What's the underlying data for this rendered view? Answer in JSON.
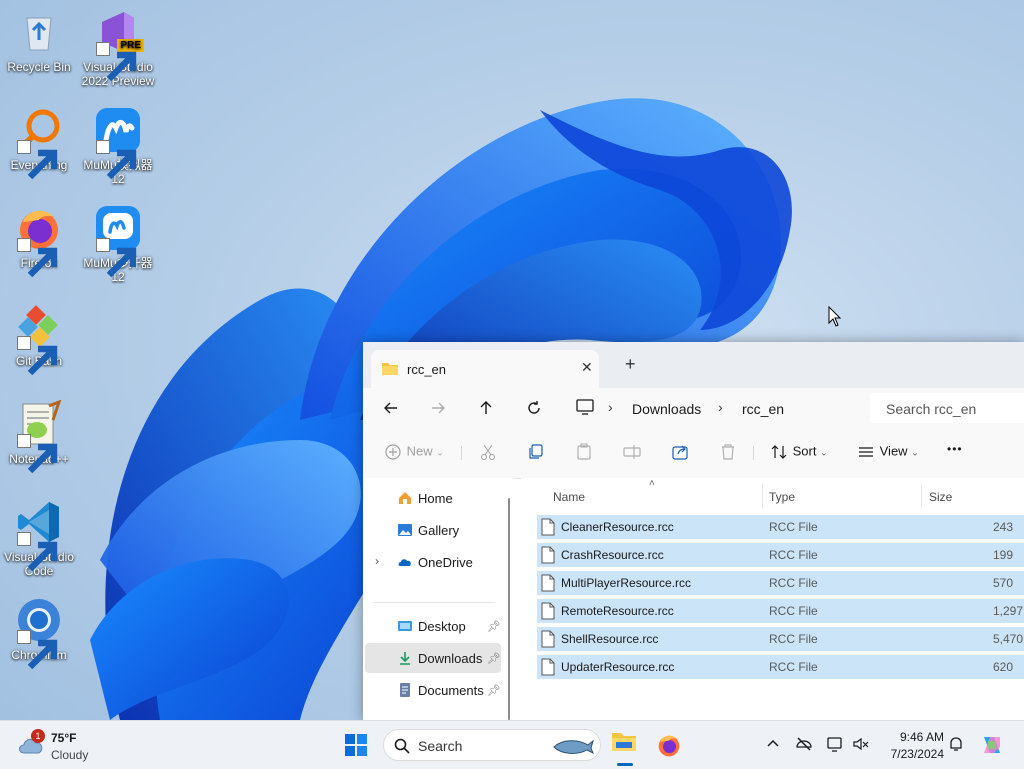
{
  "desktop": {
    "icons": [
      {
        "label": "Recycle Bin",
        "icon": "recycle-bin-icon"
      },
      {
        "label": "Visual Studio 2022 Preview",
        "badge": "PRE",
        "icon": "visual-studio-icon"
      },
      {
        "label": "Everything",
        "icon": "everything-search-icon"
      },
      {
        "label": "MuMu模拟器12",
        "icon": "mumu-emulator-icon"
      },
      {
        "label": "Firefox",
        "icon": "firefox-icon"
      },
      {
        "label": "MuMu多开器12",
        "icon": "mumu-multi-icon"
      },
      {
        "label": "Git Bash",
        "icon": "git-bash-icon"
      },
      {
        "label": "Notepad++",
        "icon": "notepad-plus-plus-icon"
      },
      {
        "label": "Visual Studio Code",
        "icon": "vscode-icon"
      },
      {
        "label": "Chromium",
        "icon": "chromium-icon"
      }
    ]
  },
  "explorer": {
    "tab_title": "rcc_en",
    "tab_close": "✕",
    "new_tab": "+",
    "breadcrumb": [
      "Downloads",
      "rcc_en"
    ],
    "search_placeholder": "Search rcc_en",
    "toolbar": {
      "new": "New",
      "sort": "Sort",
      "view": "View",
      "more": "•••"
    },
    "nav": {
      "home": "Home",
      "gallery": "Gallery",
      "onedrive": "OneDrive",
      "desktop": "Desktop",
      "downloads": "Downloads",
      "documents": "Documents"
    },
    "columns": {
      "name": "Name",
      "type": "Type",
      "size": "Size"
    },
    "files": [
      {
        "name": "CleanerResource.rcc",
        "type": "RCC File",
        "size": "243"
      },
      {
        "name": "CrashResource.rcc",
        "type": "RCC File",
        "size": "199"
      },
      {
        "name": "MultiPlayerResource.rcc",
        "type": "RCC File",
        "size": "570"
      },
      {
        "name": "RemoteResource.rcc",
        "type": "RCC File",
        "size": "1,297"
      },
      {
        "name": "ShellResource.rcc",
        "type": "RCC File",
        "size": "5,470"
      },
      {
        "name": "UpdaterResource.rcc",
        "type": "RCC File",
        "size": "620"
      }
    ]
  },
  "taskbar": {
    "weather": {
      "temp": "75°F",
      "desc": "Cloudy",
      "badge": "1"
    },
    "search_label": "Search",
    "time": "9:46 AM",
    "date": "7/23/2024"
  },
  "colors": {
    "accent": "#0067c0",
    "selection": "#cce4f7",
    "folder": "#f4c542"
  }
}
